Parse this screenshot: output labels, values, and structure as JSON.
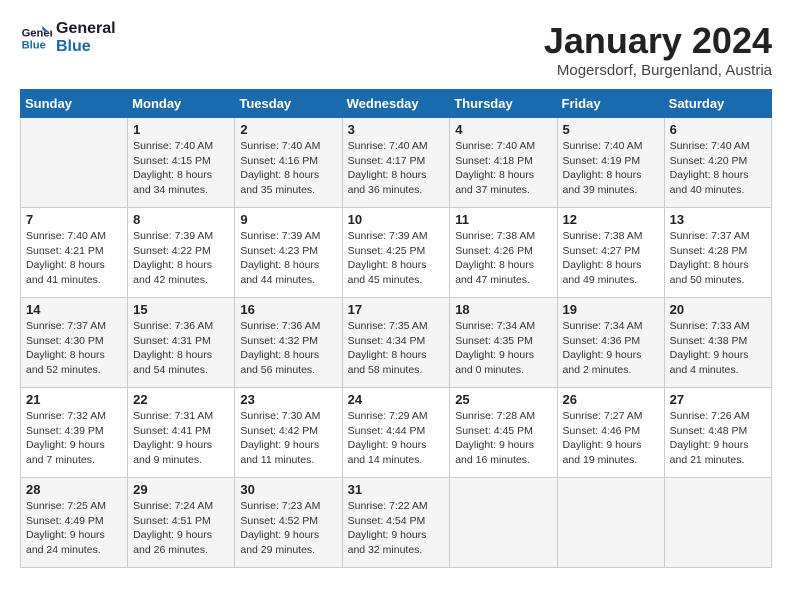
{
  "header": {
    "logo_line1": "General",
    "logo_line2": "Blue",
    "title": "January 2024",
    "subtitle": "Mogersdorf, Burgenland, Austria"
  },
  "weekdays": [
    "Sunday",
    "Monday",
    "Tuesday",
    "Wednesday",
    "Thursday",
    "Friday",
    "Saturday"
  ],
  "weeks": [
    [
      {
        "num": "",
        "info": ""
      },
      {
        "num": "1",
        "info": "Sunrise: 7:40 AM\nSunset: 4:15 PM\nDaylight: 8 hours\nand 34 minutes."
      },
      {
        "num": "2",
        "info": "Sunrise: 7:40 AM\nSunset: 4:16 PM\nDaylight: 8 hours\nand 35 minutes."
      },
      {
        "num": "3",
        "info": "Sunrise: 7:40 AM\nSunset: 4:17 PM\nDaylight: 8 hours\nand 36 minutes."
      },
      {
        "num": "4",
        "info": "Sunrise: 7:40 AM\nSunset: 4:18 PM\nDaylight: 8 hours\nand 37 minutes."
      },
      {
        "num": "5",
        "info": "Sunrise: 7:40 AM\nSunset: 4:19 PM\nDaylight: 8 hours\nand 39 minutes."
      },
      {
        "num": "6",
        "info": "Sunrise: 7:40 AM\nSunset: 4:20 PM\nDaylight: 8 hours\nand 40 minutes."
      }
    ],
    [
      {
        "num": "7",
        "info": "Sunrise: 7:40 AM\nSunset: 4:21 PM\nDaylight: 8 hours\nand 41 minutes."
      },
      {
        "num": "8",
        "info": "Sunrise: 7:39 AM\nSunset: 4:22 PM\nDaylight: 8 hours\nand 42 minutes."
      },
      {
        "num": "9",
        "info": "Sunrise: 7:39 AM\nSunset: 4:23 PM\nDaylight: 8 hours\nand 44 minutes."
      },
      {
        "num": "10",
        "info": "Sunrise: 7:39 AM\nSunset: 4:25 PM\nDaylight: 8 hours\nand 45 minutes."
      },
      {
        "num": "11",
        "info": "Sunrise: 7:38 AM\nSunset: 4:26 PM\nDaylight: 8 hours\nand 47 minutes."
      },
      {
        "num": "12",
        "info": "Sunrise: 7:38 AM\nSunset: 4:27 PM\nDaylight: 8 hours\nand 49 minutes."
      },
      {
        "num": "13",
        "info": "Sunrise: 7:37 AM\nSunset: 4:28 PM\nDaylight: 8 hours\nand 50 minutes."
      }
    ],
    [
      {
        "num": "14",
        "info": "Sunrise: 7:37 AM\nSunset: 4:30 PM\nDaylight: 8 hours\nand 52 minutes."
      },
      {
        "num": "15",
        "info": "Sunrise: 7:36 AM\nSunset: 4:31 PM\nDaylight: 8 hours\nand 54 minutes."
      },
      {
        "num": "16",
        "info": "Sunrise: 7:36 AM\nSunset: 4:32 PM\nDaylight: 8 hours\nand 56 minutes."
      },
      {
        "num": "17",
        "info": "Sunrise: 7:35 AM\nSunset: 4:34 PM\nDaylight: 8 hours\nand 58 minutes."
      },
      {
        "num": "18",
        "info": "Sunrise: 7:34 AM\nSunset: 4:35 PM\nDaylight: 9 hours\nand 0 minutes."
      },
      {
        "num": "19",
        "info": "Sunrise: 7:34 AM\nSunset: 4:36 PM\nDaylight: 9 hours\nand 2 minutes."
      },
      {
        "num": "20",
        "info": "Sunrise: 7:33 AM\nSunset: 4:38 PM\nDaylight: 9 hours\nand 4 minutes."
      }
    ],
    [
      {
        "num": "21",
        "info": "Sunrise: 7:32 AM\nSunset: 4:39 PM\nDaylight: 9 hours\nand 7 minutes."
      },
      {
        "num": "22",
        "info": "Sunrise: 7:31 AM\nSunset: 4:41 PM\nDaylight: 9 hours\nand 9 minutes."
      },
      {
        "num": "23",
        "info": "Sunrise: 7:30 AM\nSunset: 4:42 PM\nDaylight: 9 hours\nand 11 minutes."
      },
      {
        "num": "24",
        "info": "Sunrise: 7:29 AM\nSunset: 4:44 PM\nDaylight: 9 hours\nand 14 minutes."
      },
      {
        "num": "25",
        "info": "Sunrise: 7:28 AM\nSunset: 4:45 PM\nDaylight: 9 hours\nand 16 minutes."
      },
      {
        "num": "26",
        "info": "Sunrise: 7:27 AM\nSunset: 4:46 PM\nDaylight: 9 hours\nand 19 minutes."
      },
      {
        "num": "27",
        "info": "Sunrise: 7:26 AM\nSunset: 4:48 PM\nDaylight: 9 hours\nand 21 minutes."
      }
    ],
    [
      {
        "num": "28",
        "info": "Sunrise: 7:25 AM\nSunset: 4:49 PM\nDaylight: 9 hours\nand 24 minutes."
      },
      {
        "num": "29",
        "info": "Sunrise: 7:24 AM\nSunset: 4:51 PM\nDaylight: 9 hours\nand 26 minutes."
      },
      {
        "num": "30",
        "info": "Sunrise: 7:23 AM\nSunset: 4:52 PM\nDaylight: 9 hours\nand 29 minutes."
      },
      {
        "num": "31",
        "info": "Sunrise: 7:22 AM\nSunset: 4:54 PM\nDaylight: 9 hours\nand 32 minutes."
      },
      {
        "num": "",
        "info": ""
      },
      {
        "num": "",
        "info": ""
      },
      {
        "num": "",
        "info": ""
      }
    ]
  ]
}
